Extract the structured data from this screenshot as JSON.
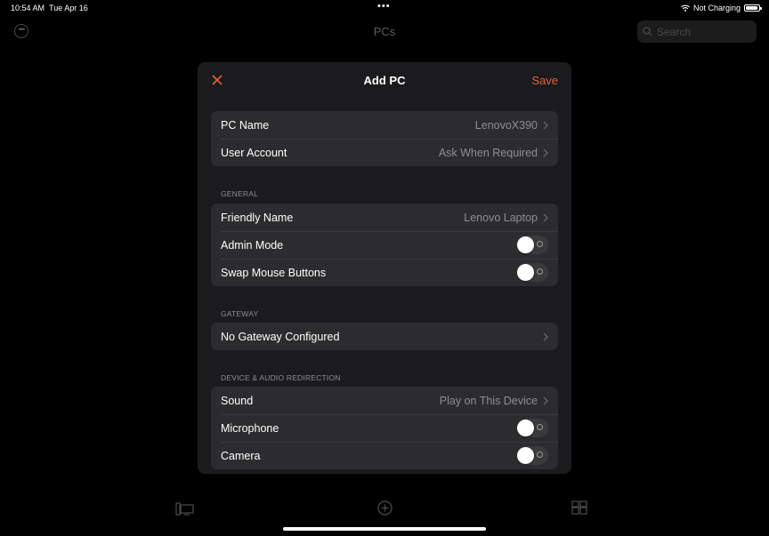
{
  "status_bar": {
    "time": "10:54 AM",
    "date": "Tue Apr 16",
    "battery_text": "Not Charging",
    "battery_level": 0.9
  },
  "background": {
    "title": "PCs",
    "search_placeholder": "Search"
  },
  "modal": {
    "title": "Add PC",
    "save_label": "Save",
    "accent_color": "#e05f3d"
  },
  "top_rows": [
    {
      "label": "PC Name",
      "value": "LenovoX390"
    },
    {
      "label": "User Account",
      "value": "Ask When Required"
    }
  ],
  "general": {
    "header": "GENERAL",
    "rows": [
      {
        "label": "Friendly Name",
        "value": "Lenovo Laptop"
      },
      {
        "label": "Admin Mode",
        "toggle": false
      },
      {
        "label": "Swap Mouse Buttons",
        "toggle": false
      }
    ]
  },
  "gateway": {
    "header": "GATEWAY",
    "rows": [
      {
        "label": "No Gateway Configured"
      }
    ]
  },
  "redirection": {
    "header": "DEVICE & AUDIO REDIRECTION",
    "rows": [
      {
        "label": "Sound",
        "value": "Play on This Device"
      },
      {
        "label": "Microphone",
        "toggle": false
      },
      {
        "label": "Camera",
        "toggle": false
      }
    ]
  }
}
